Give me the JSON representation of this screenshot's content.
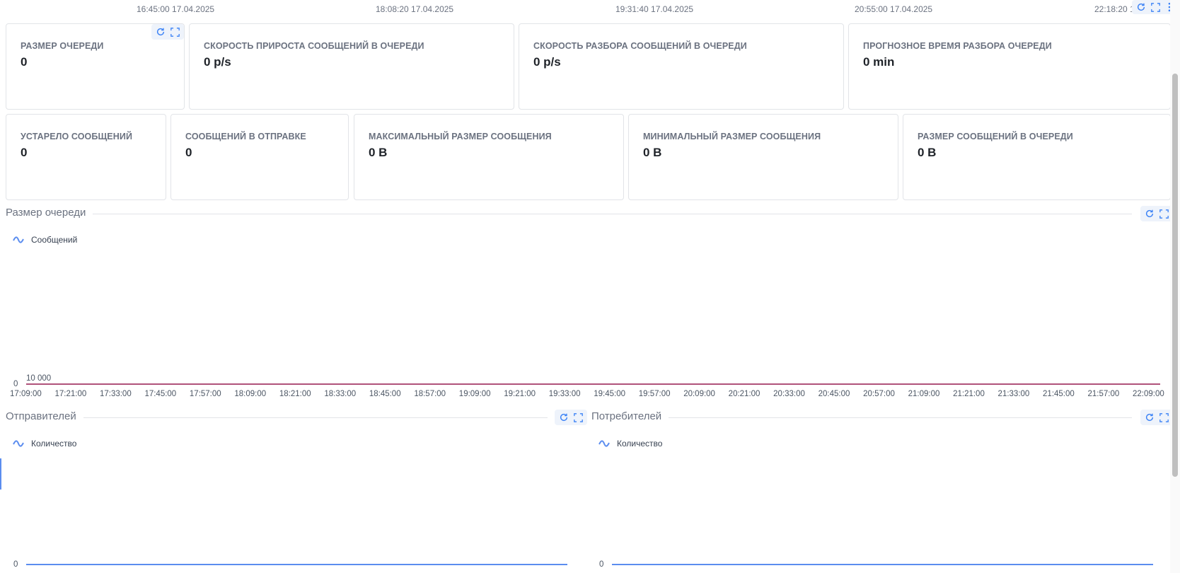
{
  "top_axis": {
    "ticks": [
      "16:45:00 17.04.2025",
      "18:08:20 17.04.2025",
      "19:31:40 17.04.2025",
      "20:55:00 17.04.2025",
      "22:18:20 1"
    ]
  },
  "metrics_row1": [
    {
      "label": "РАЗМЕР ОЧЕРЕДИ",
      "value": "0"
    },
    {
      "label": "СКОРОСТЬ ПРИРОСТА СООБЩЕНИЙ В ОЧЕРЕДИ",
      "value": "0 p/s"
    },
    {
      "label": "СКОРОСТЬ РАЗБОРА СООБЩЕНИЙ В ОЧЕРЕДИ",
      "value": "0 p/s"
    },
    {
      "label": "ПРОГНОЗНОЕ ВРЕМЯ РАЗБОРА ОЧЕРЕДИ",
      "value": "0 min"
    }
  ],
  "metrics_row2": [
    {
      "label": "УСТАРЕЛО СООБЩЕНИЙ",
      "value": "0"
    },
    {
      "label": "СООБЩЕНИЙ В ОТПРАВКЕ",
      "value": "0"
    },
    {
      "label": "МАКСИМАЛЬНЫЙ РАЗМЕР СООБЩЕНИЯ",
      "value": "0 B"
    },
    {
      "label": "МИНИМАЛЬНЫЙ РАЗМЕР СООБЩЕНИЯ",
      "value": "0 B"
    },
    {
      "label": "РАЗМЕР СООБЩЕНИЙ В ОЧЕРЕДИ",
      "value": "0 B"
    }
  ],
  "queue_chart": {
    "title": "Размер очереди",
    "legend": "Сообщений",
    "y_labels": [
      "10 000",
      "0"
    ],
    "series_color": "#b0527a",
    "x_ticks": [
      "17:09:00",
      "17:21:00",
      "17:33:00",
      "17:45:00",
      "17:57:00",
      "18:09:00",
      "18:21:00",
      "18:33:00",
      "18:45:00",
      "18:57:00",
      "19:09:00",
      "19:21:00",
      "19:33:00",
      "19:45:00",
      "19:57:00",
      "20:09:00",
      "20:21:00",
      "20:33:00",
      "20:45:00",
      "20:57:00",
      "21:09:00",
      "21:21:00",
      "21:33:00",
      "21:45:00",
      "21:57:00",
      "22:09:00"
    ]
  },
  "senders_chart": {
    "title": "Отправителей",
    "legend": "Количество",
    "y_label": "0",
    "series_color": "#5b8def"
  },
  "consumers_chart": {
    "title": "Потребителей",
    "legend": "Количество",
    "y_label": "0",
    "series_color": "#5b8def"
  },
  "chart_data": [
    {
      "type": "line",
      "title": "Размер очереди",
      "x": [
        "17:09:00",
        "17:21:00",
        "17:33:00",
        "17:45:00",
        "17:57:00",
        "18:09:00",
        "18:21:00",
        "18:33:00",
        "18:45:00",
        "18:57:00",
        "19:09:00",
        "19:21:00",
        "19:33:00",
        "19:45:00",
        "19:57:00",
        "20:09:00",
        "20:21:00",
        "20:33:00",
        "20:45:00",
        "20:57:00",
        "21:09:00",
        "21:21:00",
        "21:33:00",
        "21:45:00",
        "21:57:00",
        "22:09:00"
      ],
      "series": [
        {
          "name": "Сообщений",
          "values": [
            0,
            0,
            0,
            0,
            0,
            0,
            0,
            0,
            0,
            0,
            0,
            0,
            0,
            0,
            0,
            0,
            0,
            0,
            0,
            0,
            0,
            0,
            0,
            0,
            0,
            0
          ]
        }
      ],
      "ylim": [
        0,
        10000
      ],
      "legend": "top-left"
    },
    {
      "type": "line",
      "title": "Отправителей",
      "series": [
        {
          "name": "Количество",
          "values": [
            0,
            0,
            0,
            0,
            0,
            0,
            0,
            0,
            0,
            0,
            0,
            0,
            0,
            0
          ]
        }
      ],
      "legend": "top-left"
    },
    {
      "type": "line",
      "title": "Потребителей",
      "series": [
        {
          "name": "Количество",
          "values": [
            0,
            0,
            0,
            0,
            0,
            0,
            0,
            0,
            0,
            0,
            0,
            0,
            0,
            0
          ]
        }
      ],
      "legend": "top-left"
    }
  ],
  "icons": {
    "refresh": "refresh-icon",
    "fullscreen": "fullscreen-icon",
    "more": "more-vertical-icon",
    "legend_line": "wave-line-icon"
  }
}
